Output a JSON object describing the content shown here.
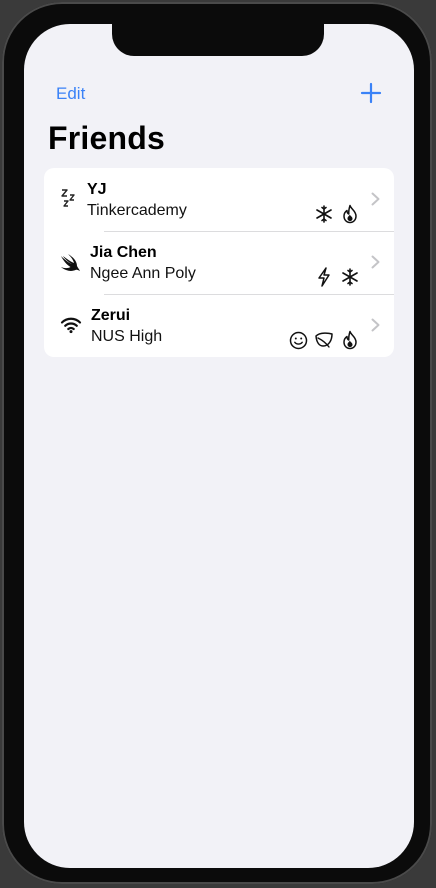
{
  "nav": {
    "edit_label": "Edit",
    "add_icon": "plus-icon"
  },
  "title": "Friends",
  "colors": {
    "accent": "#3a82f7",
    "background": "#f2f2f7",
    "card": "#ffffff"
  },
  "friends": [
    {
      "name": "YJ",
      "school": "Tinkercademy",
      "icon": "sleep-zzz-icon",
      "badges": [
        "snowflake-icon",
        "flame-icon"
      ]
    },
    {
      "name": "Jia Chen",
      "school": "Ngee Ann Poly",
      "icon": "swift-logo-icon",
      "badges": [
        "bolt-icon",
        "snowflake-icon"
      ]
    },
    {
      "name": "Zerui",
      "school": "NUS High",
      "icon": "wifi-icon",
      "badges": [
        "smiley-icon",
        "leaf-icon",
        "flame-icon"
      ]
    }
  ]
}
